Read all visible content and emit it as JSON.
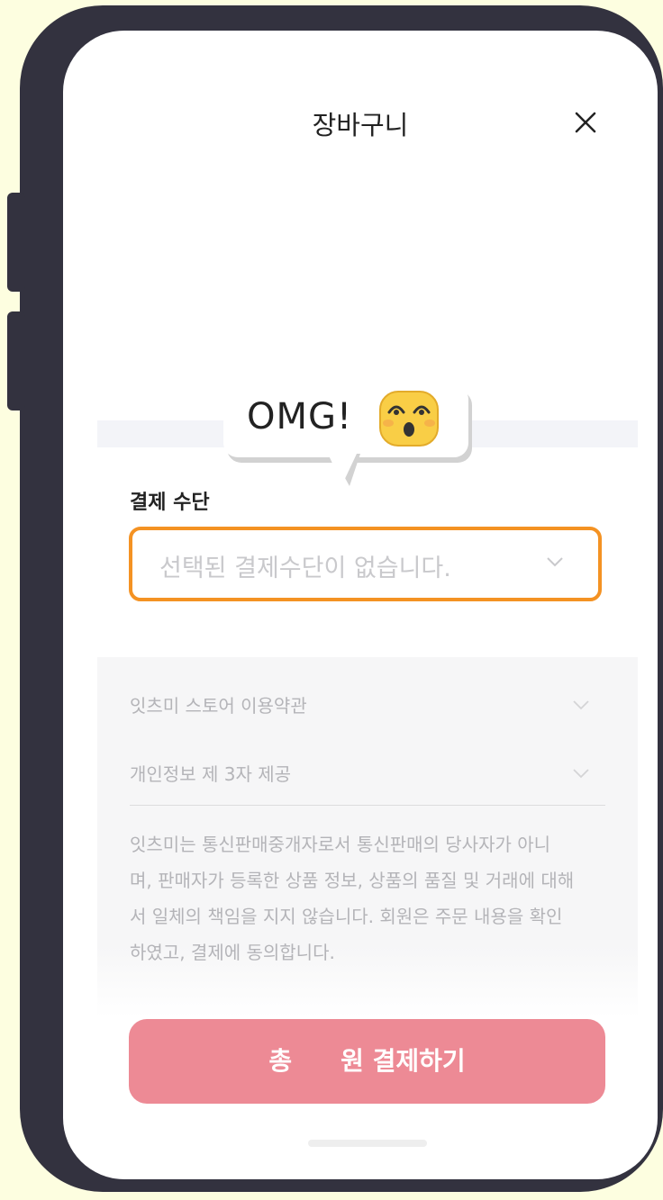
{
  "header": {
    "title": "장바구니"
  },
  "payment": {
    "label": "결제 수단",
    "placeholder": "선택된 결제수단이 없습니다."
  },
  "terms": {
    "items": [
      {
        "label": "잇츠미 스토어 이용약관"
      },
      {
        "label": "개인정보 제 3자 제공"
      }
    ],
    "notice_lines": [
      "잇츠미는 통신판매중개자로서 통신판매의 당사자가 아니",
      "며, 판매자가 등록한 상품 정보, 상품의 품질 및 거래에 대해",
      "서 일체의 책임을 지지 않습니다. 회원은 주문 내용을 확인",
      "하였고, 결제에 동의합니다."
    ]
  },
  "pay_button": {
    "prefix": "총",
    "suffix": "원 결제하기"
  },
  "bubble": {
    "text": "OMG!"
  },
  "colors": {
    "accent": "#f49223",
    "button": "#ed8a95",
    "frame": "#33323f",
    "background": "#fdfee0"
  },
  "icons": {
    "close": "close-icon",
    "chevron": "chevron-down-icon",
    "emoji": "surprised-face-emoji"
  }
}
